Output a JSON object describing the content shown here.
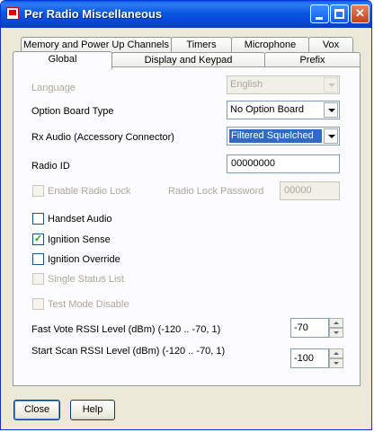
{
  "window": {
    "title": "Per Radio Miscellaneous"
  },
  "tabs": {
    "row1": [
      "Memory and Power Up Channels",
      "Timers",
      "Microphone",
      "Vox"
    ],
    "row2": [
      "Global",
      "Display and Keypad",
      "Prefix"
    ],
    "active": "Global"
  },
  "form": {
    "language": {
      "label": "Language",
      "value": "English",
      "enabled": false
    },
    "option_board_type": {
      "label": "Option Board Type",
      "value": "No Option Board"
    },
    "rx_audio": {
      "label": "Rx Audio (Accessory Connector)",
      "value": "Filtered Squelched"
    },
    "radio_id": {
      "label": "Radio ID",
      "value": "00000000"
    },
    "enable_radio_lock": {
      "label": "Enable Radio Lock",
      "checked": false,
      "enabled": false
    },
    "radio_lock_password": {
      "label": "Radio Lock Password",
      "value": "00000",
      "enabled": false
    },
    "handset_audio": {
      "label": "Handset Audio",
      "checked": false
    },
    "ignition_sense": {
      "label": "Ignition Sense",
      "checked": true
    },
    "ignition_override": {
      "label": "Ignition Override",
      "checked": false
    },
    "single_status_list": {
      "label": "Single Status List",
      "checked": false,
      "enabled": false
    },
    "test_mode_disable": {
      "label": "Test Mode Disable",
      "checked": false,
      "enabled": false
    },
    "fast_vote_rssi": {
      "label": "Fast Vote RSSI Level (dBm) (-120 .. -70, 1)",
      "value": "-70"
    },
    "start_scan_rssi": {
      "label": "Start Scan RSSI Level (dBm) (-120 .. -70, 1)",
      "value": "-100"
    }
  },
  "footer": {
    "close_label": "Close",
    "help_label": "Help"
  },
  "colors": {
    "titlebar": "#0a5fe8",
    "dialog_bg": "#ece9d8",
    "selection": "#316ac5",
    "check_mark": "#21a121"
  }
}
